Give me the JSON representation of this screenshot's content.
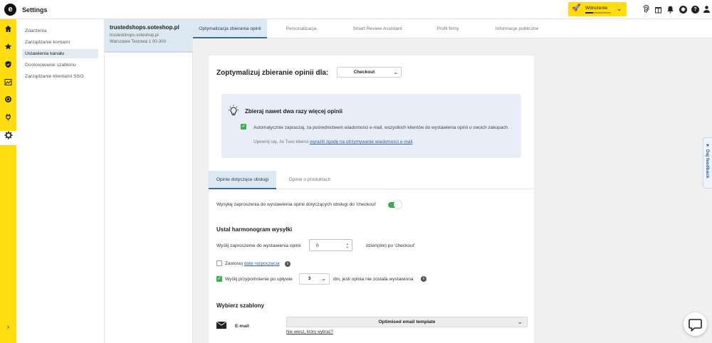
{
  "app": {
    "logo": "e",
    "title": "Settings"
  },
  "header": {
    "deploy_label": "Wdrożenie",
    "deploy_progress_fraction": 0.3,
    "icons": [
      "fingerprint-icon",
      "gift-icon",
      "bell-icon",
      "user-icon",
      "help-icon"
    ]
  },
  "rail": {
    "icons": [
      "home-icon",
      "star-icon",
      "shield-icon",
      "chart-icon",
      "review-badge-icon",
      "plug-icon",
      "gear-icon"
    ],
    "active": "gear-icon"
  },
  "nav": {
    "items": [
      {
        "label": "Zdarzenia"
      },
      {
        "label": "Zarządzanie kontami"
      },
      {
        "label": "Ustawienia kanału",
        "active": true
      },
      {
        "label": "Dostosowanie szablonu"
      },
      {
        "label": "Zarządzanie klientami SSO"
      }
    ]
  },
  "shop": {
    "name": "trustedshops.soteshop.pl",
    "domain": "trustedshops.soteshop.pl",
    "address": "Warszawa Testowa 1 00-300"
  },
  "tabs": [
    {
      "label": "Optymalizacja zbierania opinii",
      "active": true
    },
    {
      "label": "Personalizacja"
    },
    {
      "label": "Smart Review Assistant"
    },
    {
      "label": "Profil firmy"
    },
    {
      "label": "Informacje publiczne"
    }
  ],
  "optimize": {
    "heading": "Zoptymalizuj zbieranie opinii dla:",
    "event_select": "Checkout"
  },
  "banner": {
    "title": "Zbieraj nawet dwa razy więcej opinii",
    "checkbox_text": "Automatycznie zapraszaj, za pośrednictwem wiadomości e-mail, wszystkich klientów do wystawienia opinii o swoich zakupach.",
    "note_prefix": "Upewnij się, że Twoi klienci ",
    "note_link": "wyrazili zgodę na otrzymywanie wiadomości e-mail",
    "note_suffix": "."
  },
  "subtabs": [
    {
      "label": "Opinie dotyczące obsługi",
      "active": true
    },
    {
      "label": "Opinie o produktach"
    }
  ],
  "service": {
    "send_text": "Wysyłaj zaproszenia do wystawienia opinii dotyczących obsługi do 'checkout'",
    "toggle_on": true
  },
  "schedule": {
    "title": "Ustal harmonogram wysyłki",
    "send_label": "Wyślij zaproszenie do wystawienia opinii",
    "days_value": "0",
    "days_suffix": "dzień(dni) po 'checkout'",
    "apply_label": "Zastosuj ",
    "apply_link": "datę rozpoczęcia",
    "reminder_label": "Wyślij przypomnienie po upływie",
    "reminder_value": "3",
    "reminder_suffix": "dni, jeśli opinia nie została wystawiona"
  },
  "templates": {
    "title": "Wybierz szablony",
    "email_label": "E-mail",
    "email_template": "Optimised email template",
    "help_link": "Nie wiesz, który wybrać?"
  },
  "feedback": {
    "label": "Daj feedback"
  },
  "colors": {
    "brand_yellow": "#ffdc0f",
    "active_blue_bg": "#dce8f2",
    "success_green": "#3bae4e",
    "link_blue": "#2f5f9e",
    "banner_bg": "#e8edf8"
  }
}
